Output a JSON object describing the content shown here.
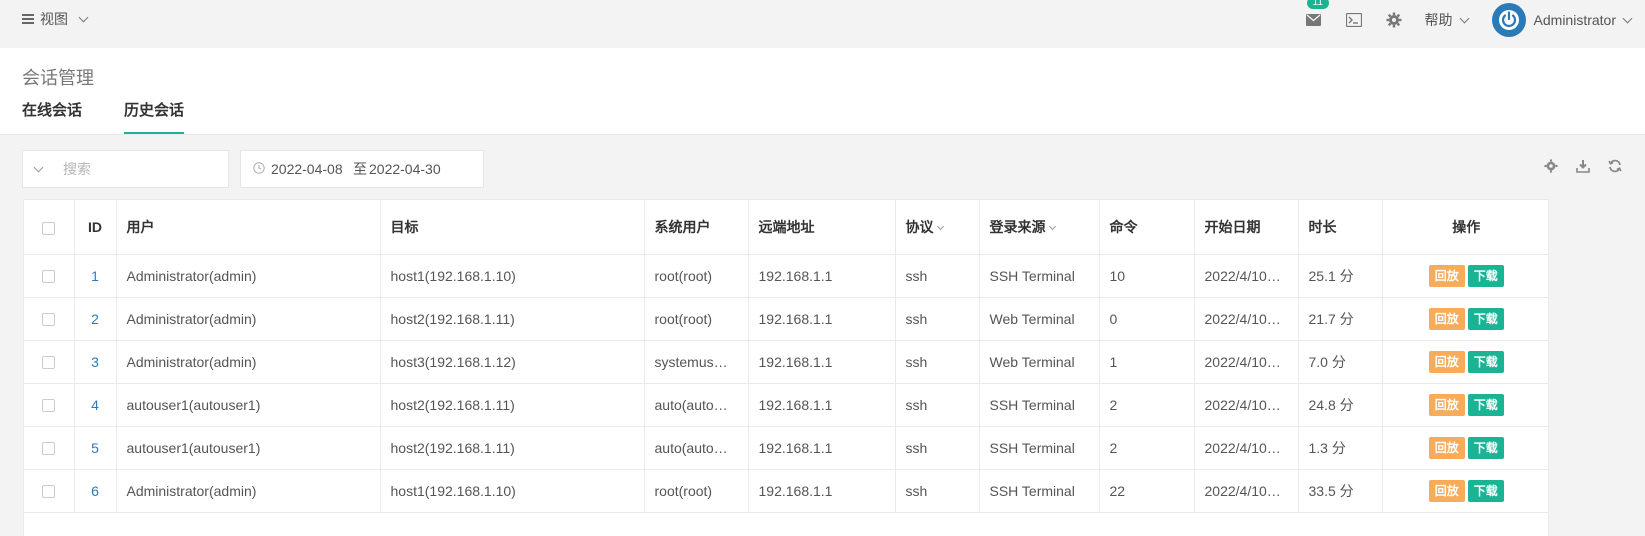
{
  "topbar": {
    "view_label": "视图",
    "mail_badge": "11",
    "help_label": "帮助",
    "user_name": "Administrator",
    "icons": [
      "mail-icon",
      "terminal-icon",
      "gear-icon"
    ]
  },
  "page": {
    "title": "会话管理",
    "tabs": [
      "在线会话",
      "历史会话"
    ],
    "active_tab": "历史会话"
  },
  "filters": {
    "search_placeholder": "搜索",
    "date_from": "2022-04-08",
    "date_sep": "至",
    "date_to": "2022-04-30"
  },
  "toolbar_icons": [
    "settings-icon",
    "download-icon",
    "refresh-icon"
  ],
  "table": {
    "columns": [
      "ID",
      "用户",
      "目标",
      "系统用户",
      "远端地址",
      "协议",
      "登录来源",
      "命令",
      "开始日期",
      "时长",
      "操作"
    ],
    "rows": [
      {
        "id": "1",
        "user": "Administrator(admin)",
        "target": "host1(192.168.1.10)",
        "sys_user": "root(root)",
        "remote": "192.168.1.1",
        "protocol": "ssh",
        "source": "SSH Terminal",
        "commands": "10",
        "start": "2022/4/10…",
        "duration": "25.1 分"
      },
      {
        "id": "2",
        "user": "Administrator(admin)",
        "target": "host2(192.168.1.11)",
        "sys_user": "root(root)",
        "remote": "192.168.1.1",
        "protocol": "ssh",
        "source": "Web Terminal",
        "commands": "0",
        "start": "2022/4/10…",
        "duration": "21.7 分"
      },
      {
        "id": "3",
        "user": "Administrator(admin)",
        "target": "host3(192.168.1.12)",
        "sys_user": "systemus…",
        "remote": "192.168.1.1",
        "protocol": "ssh",
        "source": "Web Terminal",
        "commands": "1",
        "start": "2022/4/10…",
        "duration": "7.0 分"
      },
      {
        "id": "4",
        "user": "autouser1(autouser1)",
        "target": "host2(192.168.1.11)",
        "sys_user": "auto(auto…",
        "remote": "192.168.1.1",
        "protocol": "ssh",
        "source": "SSH Terminal",
        "commands": "2",
        "start": "2022/4/10…",
        "duration": "24.8 分"
      },
      {
        "id": "5",
        "user": "autouser1(autouser1)",
        "target": "host2(192.168.1.11)",
        "sys_user": "auto(auto…",
        "remote": "192.168.1.1",
        "protocol": "ssh",
        "source": "SSH Terminal",
        "commands": "2",
        "start": "2022/4/10…",
        "duration": "1.3 分"
      },
      {
        "id": "6",
        "user": "Administrator(admin)",
        "target": "host1(192.168.1.10)",
        "sys_user": "root(root)",
        "remote": "192.168.1.1",
        "protocol": "ssh",
        "source": "SSH Terminal",
        "commands": "22",
        "start": "2022/4/10…",
        "duration": "33.5 分"
      }
    ],
    "actions": {
      "replay": "回放",
      "download": "下载"
    }
  },
  "colors": {
    "accent": "#1ab394",
    "warning": "#f8ac59",
    "link": "#2f7ab5",
    "avatar": "#2a7ab8"
  }
}
